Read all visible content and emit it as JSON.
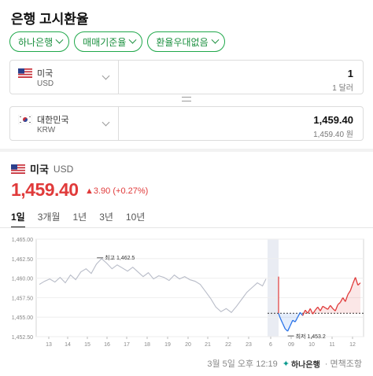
{
  "page_title": "은행 고시환율",
  "filters": [
    {
      "label": "하나은행"
    },
    {
      "label": "매매기준율"
    },
    {
      "label": "환율우대없음"
    }
  ],
  "converter": {
    "from": {
      "name": "미국",
      "code": "USD",
      "value": "1",
      "sub": "1 달러"
    },
    "to": {
      "name": "대한민국",
      "code": "KRW",
      "value": "1,459.40",
      "sub": "1,459.40 원"
    }
  },
  "quote": {
    "name": "미국",
    "code": "USD",
    "price": "1,459.40",
    "change": "▲3.90 (+0.27%)"
  },
  "period_tabs": [
    "1일",
    "3개월",
    "1년",
    "3년",
    "10년"
  ],
  "active_tab": "1일",
  "colors": {
    "up": "#e03a3a",
    "down": "#2a73e8",
    "accent": "#1fa84a"
  },
  "chart_data": {
    "type": "line",
    "y_ticks": [
      "1,465.00",
      "1,462.50",
      "1,460.00",
      "1,457.50",
      "1,455.00",
      "1,452.50"
    ],
    "ylim": [
      1452.5,
      1465.0
    ],
    "x_ticks": [
      "13",
      "14",
      "15",
      "16",
      "17",
      "18",
      "19",
      "20",
      "21",
      "22",
      "23",
      "6",
      "09",
      "10",
      "11",
      "12"
    ],
    "annotations": {
      "high_label": "최고",
      "high_value": "1,462.5",
      "low_label": "최저",
      "low_value": "1,453.2"
    },
    "baseline": 1455.5,
    "history": [
      [
        0,
        1459.2
      ],
      [
        3,
        1459.6
      ],
      [
        6,
        1459.9
      ],
      [
        9,
        1459.5
      ],
      [
        12,
        1460.1
      ],
      [
        15,
        1459.4
      ],
      [
        18,
        1460.4
      ],
      [
        21,
        1459.8
      ],
      [
        24,
        1460.8
      ],
      [
        27,
        1461.2
      ],
      [
        30,
        1460.6
      ],
      [
        33,
        1461.8
      ],
      [
        36,
        1462.5
      ],
      [
        39,
        1461.9
      ],
      [
        42,
        1461.2
      ],
      [
        45,
        1461.7
      ],
      [
        48,
        1461.3
      ],
      [
        51,
        1460.9
      ],
      [
        54,
        1461.4
      ],
      [
        57,
        1460.8
      ],
      [
        60,
        1460.2
      ],
      [
        63,
        1460.7
      ],
      [
        66,
        1459.9
      ],
      [
        69,
        1460.3
      ],
      [
        72,
        1460.1
      ],
      [
        75,
        1459.7
      ],
      [
        78,
        1460.4
      ],
      [
        81,
        1459.9
      ],
      [
        84,
        1460.2
      ],
      [
        87,
        1459.8
      ],
      [
        90,
        1459.6
      ],
      [
        93,
        1459.2
      ],
      [
        96,
        1458.3
      ],
      [
        99,
        1457.4
      ],
      [
        102,
        1456.3
      ],
      [
        105,
        1455.7
      ],
      [
        108,
        1456.1
      ],
      [
        111,
        1455.6
      ],
      [
        114,
        1456.4
      ],
      [
        117,
        1457.3
      ],
      [
        120,
        1458.2
      ],
      [
        123,
        1458.8
      ],
      [
        126,
        1459.4
      ],
      [
        129,
        1459.0
      ],
      [
        131,
        1459.9
      ]
    ],
    "today": [
      [
        0,
        1454.9
      ],
      [
        2,
        1454.2
      ],
      [
        4,
        1453.5
      ],
      [
        6,
        1453.2
      ],
      [
        8,
        1453.9
      ],
      [
        10,
        1454.6
      ],
      [
        12,
        1454.4
      ],
      [
        14,
        1455.0
      ],
      [
        16,
        1455.6
      ],
      [
        18,
        1455.2
      ],
      [
        20,
        1455.9
      ],
      [
        22,
        1455.5
      ],
      [
        24,
        1456.1
      ],
      [
        26,
        1455.4
      ],
      [
        28,
        1455.9
      ],
      [
        30,
        1456.3
      ],
      [
        32,
        1455.8
      ],
      [
        34,
        1456.4
      ],
      [
        36,
        1456.2
      ],
      [
        38,
        1456.0
      ],
      [
        40,
        1456.5
      ],
      [
        42,
        1456.1
      ],
      [
        44,
        1455.8
      ],
      [
        46,
        1456.6
      ],
      [
        48,
        1456.9
      ],
      [
        50,
        1457.5
      ],
      [
        52,
        1457.0
      ],
      [
        54,
        1457.9
      ],
      [
        56,
        1458.4
      ],
      [
        58,
        1459.3
      ],
      [
        60,
        1460.1
      ],
      [
        62,
        1459.1
      ],
      [
        64,
        1459.4
      ]
    ]
  }
}
